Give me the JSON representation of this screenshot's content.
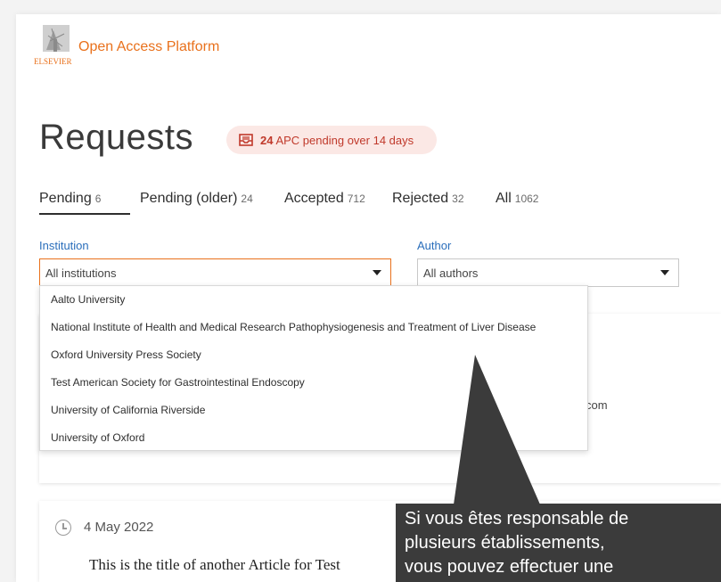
{
  "brand": {
    "logo_alt": "ELSEVIER",
    "name": "Open Access Platform"
  },
  "page": {
    "title": "Requests",
    "badge": {
      "count": "24",
      "text": "APC pending over 14 days",
      "icon": "inbox-icon"
    }
  },
  "tabs": [
    {
      "label": "Pending",
      "count": "6"
    },
    {
      "label": "Pending (older)",
      "count": "24"
    },
    {
      "label": "Accepted",
      "count": "712"
    },
    {
      "label": "Rejected",
      "count": "32"
    },
    {
      "label": "All",
      "count": "1062"
    }
  ],
  "filters": {
    "institution": {
      "label": "Institution",
      "value": "All institutions"
    },
    "author": {
      "label": "Author",
      "value": "All authors"
    }
  },
  "institution_options": [
    "Aalto University",
    "National Institute of Health and Medical Research Pathophysiogenesis and Treatment of Liver Disease",
    "Oxford University Press Society",
    "Test American Society for Gastrointestinal Endoscopy",
    "University of California Riverside",
    "University of Oxford"
  ],
  "card1": {
    "partial_text": "com"
  },
  "card2": {
    "date": "4 May 2022",
    "title": "This is the title of another Article for Test"
  },
  "tooltip": {
    "lines": [
      "Si vous êtes responsable de",
      "plusieurs établissements,",
      "vous pouvez effectuer une"
    ]
  },
  "colors": {
    "accent": "#e9711c",
    "link": "#2a6ebb",
    "badge_bg": "#fbe8e5",
    "badge_text": "#c0392b",
    "tooltip_bg": "#3b3b3b"
  }
}
